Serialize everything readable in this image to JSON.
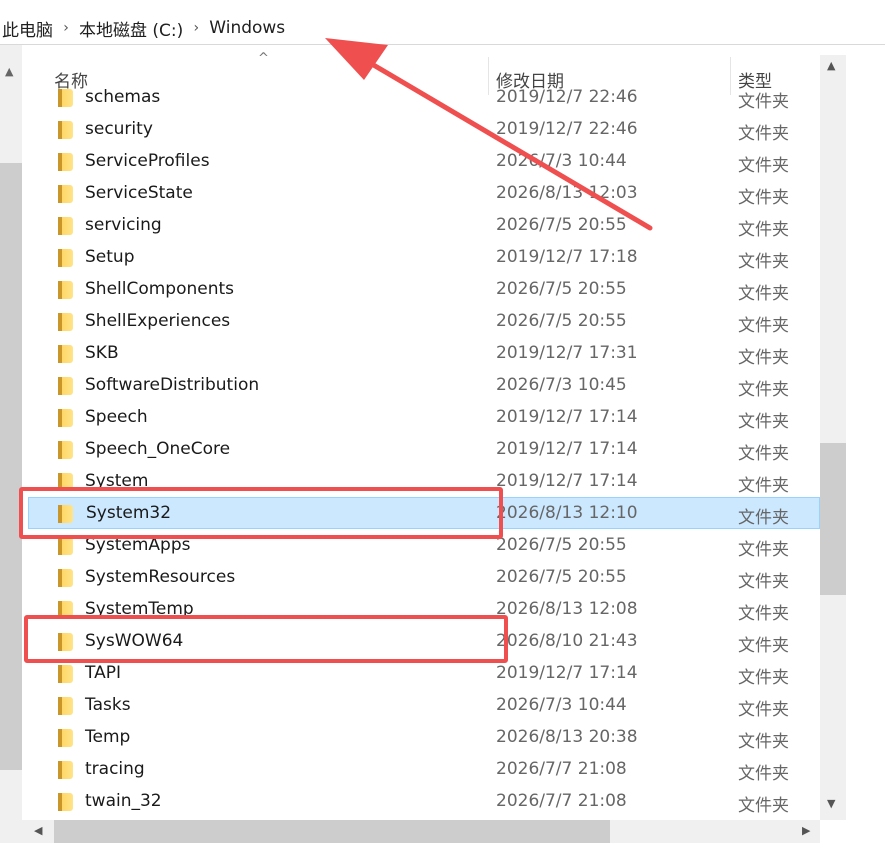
{
  "breadcrumb": {
    "items": [
      "此电脑",
      "本地磁盘 (C:)",
      "Windows"
    ],
    "separator": "›"
  },
  "columns": {
    "name": "名称",
    "date": "修改日期",
    "type": "类型"
  },
  "files": [
    {
      "name": "schemas",
      "date": "2019/12/7 22:46",
      "type": "文件夹"
    },
    {
      "name": "security",
      "date": "2019/12/7 22:46",
      "type": "文件夹"
    },
    {
      "name": "ServiceProfiles",
      "date": "2026/7/3 10:44",
      "type": "文件夹"
    },
    {
      "name": "ServiceState",
      "date": "2026/8/13 12:03",
      "type": "文件夹"
    },
    {
      "name": "servicing",
      "date": "2026/7/5 20:55",
      "type": "文件夹"
    },
    {
      "name": "Setup",
      "date": "2019/12/7 17:18",
      "type": "文件夹"
    },
    {
      "name": "ShellComponents",
      "date": "2026/7/5 20:55",
      "type": "文件夹"
    },
    {
      "name": "ShellExperiences",
      "date": "2026/7/5 20:55",
      "type": "文件夹"
    },
    {
      "name": "SKB",
      "date": "2019/12/7 17:31",
      "type": "文件夹"
    },
    {
      "name": "SoftwareDistribution",
      "date": "2026/7/3 10:45",
      "type": "文件夹"
    },
    {
      "name": "Speech",
      "date": "2019/12/7 17:14",
      "type": "文件夹"
    },
    {
      "name": "Speech_OneCore",
      "date": "2019/12/7 17:14",
      "type": "文件夹"
    },
    {
      "name": "System",
      "date": "2019/12/7 17:14",
      "type": "文件夹"
    },
    {
      "name": "System32",
      "date": "2026/8/13 12:10",
      "type": "文件夹",
      "selected": true
    },
    {
      "name": "SystemApps",
      "date": "2026/7/5 20:55",
      "type": "文件夹"
    },
    {
      "name": "SystemResources",
      "date": "2026/7/5 20:55",
      "type": "文件夹"
    },
    {
      "name": "SystemTemp",
      "date": "2026/8/13 12:08",
      "type": "文件夹"
    },
    {
      "name": "SysWOW64",
      "date": "2026/8/10 21:43",
      "type": "文件夹"
    },
    {
      "name": "TAPI",
      "date": "2019/12/7 17:14",
      "type": "文件夹"
    },
    {
      "name": "Tasks",
      "date": "2026/7/3 10:44",
      "type": "文件夹"
    },
    {
      "name": "Temp",
      "date": "2026/8/13 20:38",
      "type": "文件夹"
    },
    {
      "name": "tracing",
      "date": "2026/7/7 21:08",
      "type": "文件夹"
    },
    {
      "name": "twain_32",
      "date": "2026/7/7 21:08",
      "type": "文件夹"
    }
  ],
  "colors": {
    "selection": "#cce8ff",
    "annotation": "#ef4f4f",
    "folder": "#ffd868"
  }
}
